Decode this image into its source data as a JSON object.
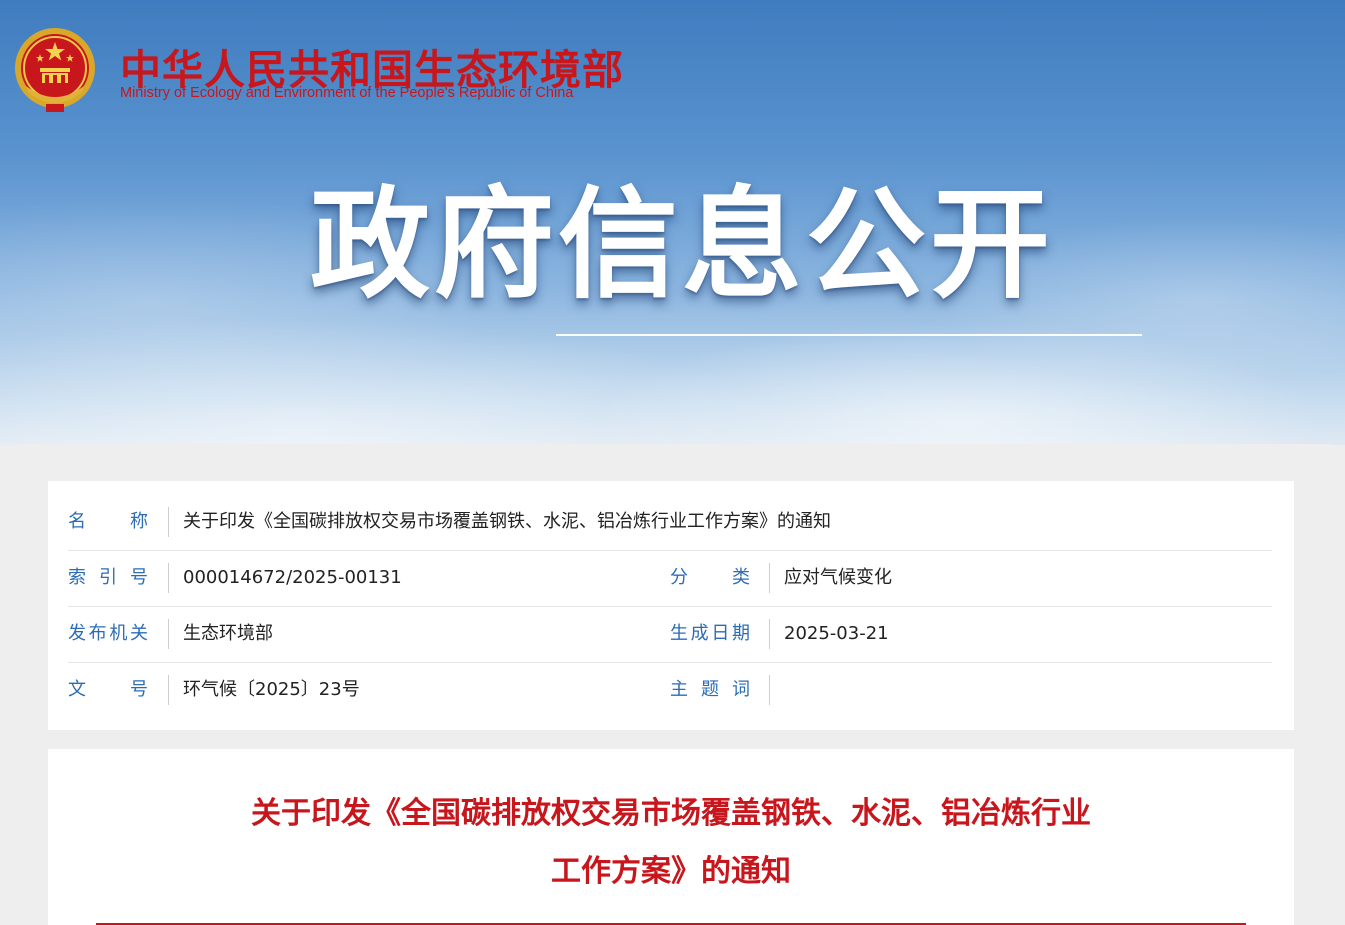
{
  "header": {
    "org_name_cn": "中华人民共和国生态环境部",
    "org_name_en": "Ministry of Ecology and Environment of the People's Republic of China",
    "emblem_icon": "national-emblem-icon",
    "brand_red": "#c8161d"
  },
  "banner": {
    "title": "政府信息公开"
  },
  "meta": {
    "label_color": "#2b6cb4",
    "name": {
      "label": "名　称",
      "value": "关于印发《全国碳排放权交易市场覆盖钢铁、水泥、铝冶炼行业工作方案》的通知"
    },
    "index": {
      "label": "索 引 号",
      "value": "000014672/2025-00131"
    },
    "category": {
      "label": "分　类",
      "value": "应对气候变化"
    },
    "issuer": {
      "label": "发布机关",
      "value": "生态环境部"
    },
    "date": {
      "label": "生成日期",
      "value": "2025-03-21"
    },
    "doc_no": {
      "label": "文　号",
      "value": "环气候〔2025〕23号"
    },
    "keywords": {
      "label": "主 题 词",
      "value": ""
    }
  },
  "article": {
    "title_line1": "关于印发《全国碳排放权交易市场覆盖钢铁、水泥、铝冶炼行业",
    "title_line2": "工作方案》的通知"
  }
}
